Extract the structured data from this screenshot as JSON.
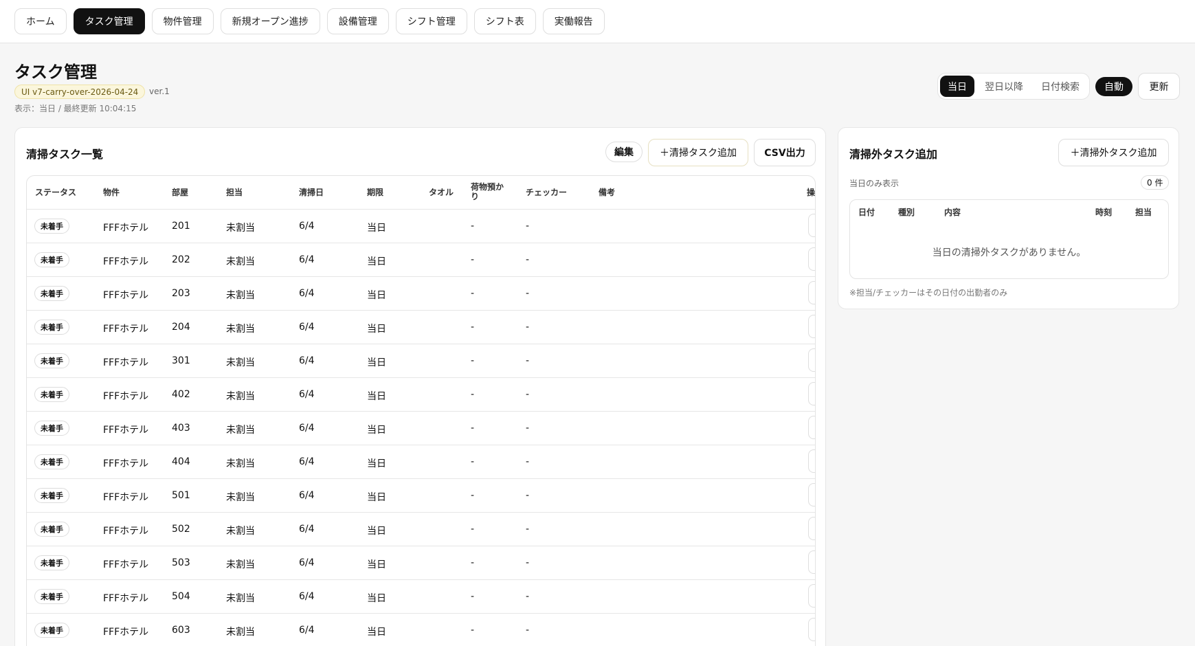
{
  "nav": [
    {
      "label": "ホーム",
      "active": false
    },
    {
      "label": "タスク管理",
      "active": true
    },
    {
      "label": "物件管理",
      "active": false
    },
    {
      "label": "新規オープン進捗",
      "active": false
    },
    {
      "label": "設備管理",
      "active": false
    },
    {
      "label": "シフト管理",
      "active": false
    },
    {
      "label": "シフト表",
      "active": false
    },
    {
      "label": "実働報告",
      "active": false
    }
  ],
  "header": {
    "title": "タスク管理",
    "ui_badge": "UI v7-carry-over-2026-04-24",
    "version": "ver.1",
    "meta": "表示：当日 / 最終更新 10:04:15"
  },
  "view_toggle": {
    "options": [
      {
        "label": "当日",
        "active": true
      },
      {
        "label": "翌日以降",
        "active": false
      },
      {
        "label": "日付検索",
        "active": false
      }
    ],
    "auto_label": "自動",
    "refresh_label": "更新"
  },
  "cleaning": {
    "title": "清掃タスク一覧",
    "edit_label": "編集",
    "add_label": "＋清掃タスク追加",
    "csv_label": "CSV出力",
    "columns": {
      "status": "ステータス",
      "property": "物件",
      "room": "部屋",
      "assignee": "担当",
      "date": "清掃日",
      "deadline": "期限",
      "towel": "タオル",
      "luggage": "荷物預かり",
      "checker": "チェッカー",
      "notes": "備考",
      "ops": "操"
    },
    "rows": [
      {
        "status": "未着手",
        "property": "FFFホテル",
        "room": "201",
        "assignee": "未割当",
        "date": "6/4",
        "deadline": "当日",
        "luggage": "-",
        "checker": "-"
      },
      {
        "status": "未着手",
        "property": "FFFホテル",
        "room": "202",
        "assignee": "未割当",
        "date": "6/4",
        "deadline": "当日",
        "luggage": "-",
        "checker": "-"
      },
      {
        "status": "未着手",
        "property": "FFFホテル",
        "room": "203",
        "assignee": "未割当",
        "date": "6/4",
        "deadline": "当日",
        "luggage": "-",
        "checker": "-"
      },
      {
        "status": "未着手",
        "property": "FFFホテル",
        "room": "204",
        "assignee": "未割当",
        "date": "6/4",
        "deadline": "当日",
        "luggage": "-",
        "checker": "-"
      },
      {
        "status": "未着手",
        "property": "FFFホテル",
        "room": "301",
        "assignee": "未割当",
        "date": "6/4",
        "deadline": "当日",
        "luggage": "-",
        "checker": "-"
      },
      {
        "status": "未着手",
        "property": "FFFホテル",
        "room": "402",
        "assignee": "未割当",
        "date": "6/4",
        "deadline": "当日",
        "luggage": "-",
        "checker": "-"
      },
      {
        "status": "未着手",
        "property": "FFFホテル",
        "room": "403",
        "assignee": "未割当",
        "date": "6/4",
        "deadline": "当日",
        "luggage": "-",
        "checker": "-"
      },
      {
        "status": "未着手",
        "property": "FFFホテル",
        "room": "404",
        "assignee": "未割当",
        "date": "6/4",
        "deadline": "当日",
        "luggage": "-",
        "checker": "-"
      },
      {
        "status": "未着手",
        "property": "FFFホテル",
        "room": "501",
        "assignee": "未割当",
        "date": "6/4",
        "deadline": "当日",
        "luggage": "-",
        "checker": "-"
      },
      {
        "status": "未着手",
        "property": "FFFホテル",
        "room": "502",
        "assignee": "未割当",
        "date": "6/4",
        "deadline": "当日",
        "luggage": "-",
        "checker": "-"
      },
      {
        "status": "未着手",
        "property": "FFFホテル",
        "room": "503",
        "assignee": "未割当",
        "date": "6/4",
        "deadline": "当日",
        "luggage": "-",
        "checker": "-"
      },
      {
        "status": "未着手",
        "property": "FFFホテル",
        "room": "504",
        "assignee": "未割当",
        "date": "6/4",
        "deadline": "当日",
        "luggage": "-",
        "checker": "-"
      },
      {
        "status": "未着手",
        "property": "FFFホテル",
        "room": "603",
        "assignee": "未割当",
        "date": "6/4",
        "deadline": "当日",
        "luggage": "-",
        "checker": "-"
      }
    ]
  },
  "other_tasks": {
    "title": "清掃外タスク追加",
    "add_label": "＋清掃外タスク追加",
    "filter_text": "当日のみ表示",
    "count": "0 件",
    "columns": {
      "date": "日付",
      "type": "種別",
      "content": "内容",
      "time": "時刻",
      "assignee": "担当"
    },
    "empty_message": "当日の清掃外タスクがありません。",
    "note": "※担当/チェッカーはその日付の出勤者のみ"
  },
  "colors": {
    "accent": "#111111",
    "badge_bg": "#fbf6dc",
    "border": "#e3e3e3"
  }
}
